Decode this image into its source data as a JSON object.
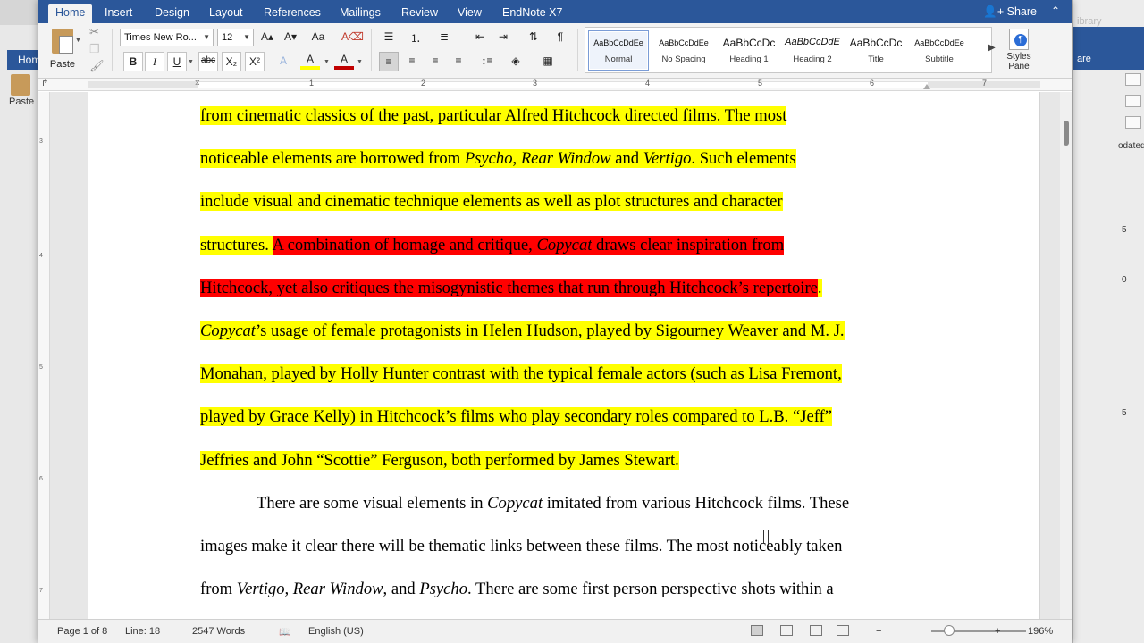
{
  "app": {
    "tabs": [
      "Home",
      "Insert",
      "Design",
      "Layout",
      "References",
      "Mailings",
      "Review",
      "View",
      "EndNote X7"
    ],
    "share_label": "Share",
    "share_icon": "person-plus-icon"
  },
  "ribbon": {
    "paste_label": "Paste",
    "font_name": "Times New Ro...",
    "font_size": "12",
    "bold": "B",
    "italic": "I",
    "underline": "U",
    "strike": "abc",
    "subscript": "X₂",
    "superscript": "X²",
    "grow_font": "A▴",
    "shrink_font": "A▾",
    "change_case": "Aa",
    "text_effects": "A",
    "highlight": "A",
    "font_color": "A",
    "pilcrow": "¶",
    "styles": [
      {
        "sample": "AaBbCcDdEe",
        "name": "Normal",
        "selected": true
      },
      {
        "sample": "AaBbCcDdEe",
        "name": "No Spacing",
        "selected": false
      },
      {
        "sample": "AaBbCcDc",
        "name": "Heading 1",
        "selected": false
      },
      {
        "sample": "AaBbCcDdE",
        "name": "Heading 2",
        "selected": false
      },
      {
        "sample": "AaBbCcDc",
        "name": "Title",
        "selected": false
      },
      {
        "sample": "AaBbCcDdEe",
        "name": "Subtitle",
        "selected": false
      }
    ],
    "styles_pane_label": "Styles Pane",
    "colors": {
      "highlight": "#ffff00",
      "font": "#c00000",
      "accent": "#2b579a"
    }
  },
  "ruler": {
    "numbers": [
      "1",
      "2",
      "3",
      "4",
      "5",
      "6",
      "7"
    ]
  },
  "document": {
    "lines": [
      {
        "segments": [
          {
            "t": "from cinematic classics of the past, particular Alfred Hitchcock directed films. The most",
            "h": "y"
          }
        ]
      },
      {
        "segments": [
          {
            "t": "noticeable elements are borrowed from ",
            "h": "y"
          },
          {
            "t": "Psycho",
            "h": "y",
            "i": true
          },
          {
            "t": ", ",
            "h": "y"
          },
          {
            "t": "Rear Window",
            "h": "y",
            "i": true
          },
          {
            "t": " and ",
            "h": "y"
          },
          {
            "t": "Vertigo",
            "h": "y",
            "i": true
          },
          {
            "t": ". Such elements",
            "h": "y"
          }
        ]
      },
      {
        "segments": [
          {
            "t": "include visual and cinematic technique elements as well as plot structures and character",
            "h": "y"
          }
        ]
      },
      {
        "segments": [
          {
            "t": "structures. ",
            "h": "y"
          },
          {
            "t": "A combination of homage and critique, ",
            "h": "r"
          },
          {
            "t": "Copycat",
            "h": "r",
            "i": true
          },
          {
            "t": " draws clear inspiration from",
            "h": "r"
          }
        ]
      },
      {
        "segments": [
          {
            "t": "Hitchcock, yet also critiques the misogynistic themes that run through Hitchcock’s repertoire",
            "h": "r"
          },
          {
            "t": ".",
            "h": "y"
          }
        ]
      },
      {
        "segments": [
          {
            "t": "Copycat",
            "h": "y",
            "i": true
          },
          {
            "t": "’s usage of female protagonists in Helen Hudson, played by Sigourney Weaver and M. J.",
            "h": "y"
          }
        ]
      },
      {
        "segments": [
          {
            "t": "Monahan, played by Holly Hunter contrast with the typical female actors (such as Lisa Fremont,",
            "h": "y"
          }
        ]
      },
      {
        "segments": [
          {
            "t": "played by Grace Kelly) in Hitchcock’s films who play secondary roles compared to L.B. “Jeff”",
            "h": "y"
          }
        ]
      },
      {
        "segments": [
          {
            "t": "Jeffries and John “Scottie” Ferguson, both performed by James Stewart.",
            "h": "y"
          }
        ]
      },
      {
        "indent": true,
        "segments": [
          {
            "t": "There are some visual elements in "
          },
          {
            "t": "Copycat",
            "i": true
          },
          {
            "t": " imitated from various Hitchcock films. These"
          }
        ]
      },
      {
        "segments": [
          {
            "t": "images make it clear there will be thematic links between these films. The most noticeably taken"
          }
        ]
      },
      {
        "segments": [
          {
            "t": "from "
          },
          {
            "t": "Vertigo, Rear Window",
            "i": true
          },
          {
            "t": ", and "
          },
          {
            "t": "Psycho",
            "i": true
          },
          {
            "t": ". There are some first person perspective shots within a"
          }
        ]
      }
    ]
  },
  "status": {
    "page": "Page 1 of 8",
    "line": "Line: 18",
    "words": "2547 Words",
    "language": "English (US)",
    "zoom_minus": "−",
    "zoom_plus": "+",
    "zoom": "196%"
  },
  "background_window": {
    "tab": "Hom",
    "paste": "Paste",
    "library": "ibrary",
    "share": "are",
    "updated": "odated",
    "nums": [
      "5",
      "0",
      "5"
    ]
  }
}
